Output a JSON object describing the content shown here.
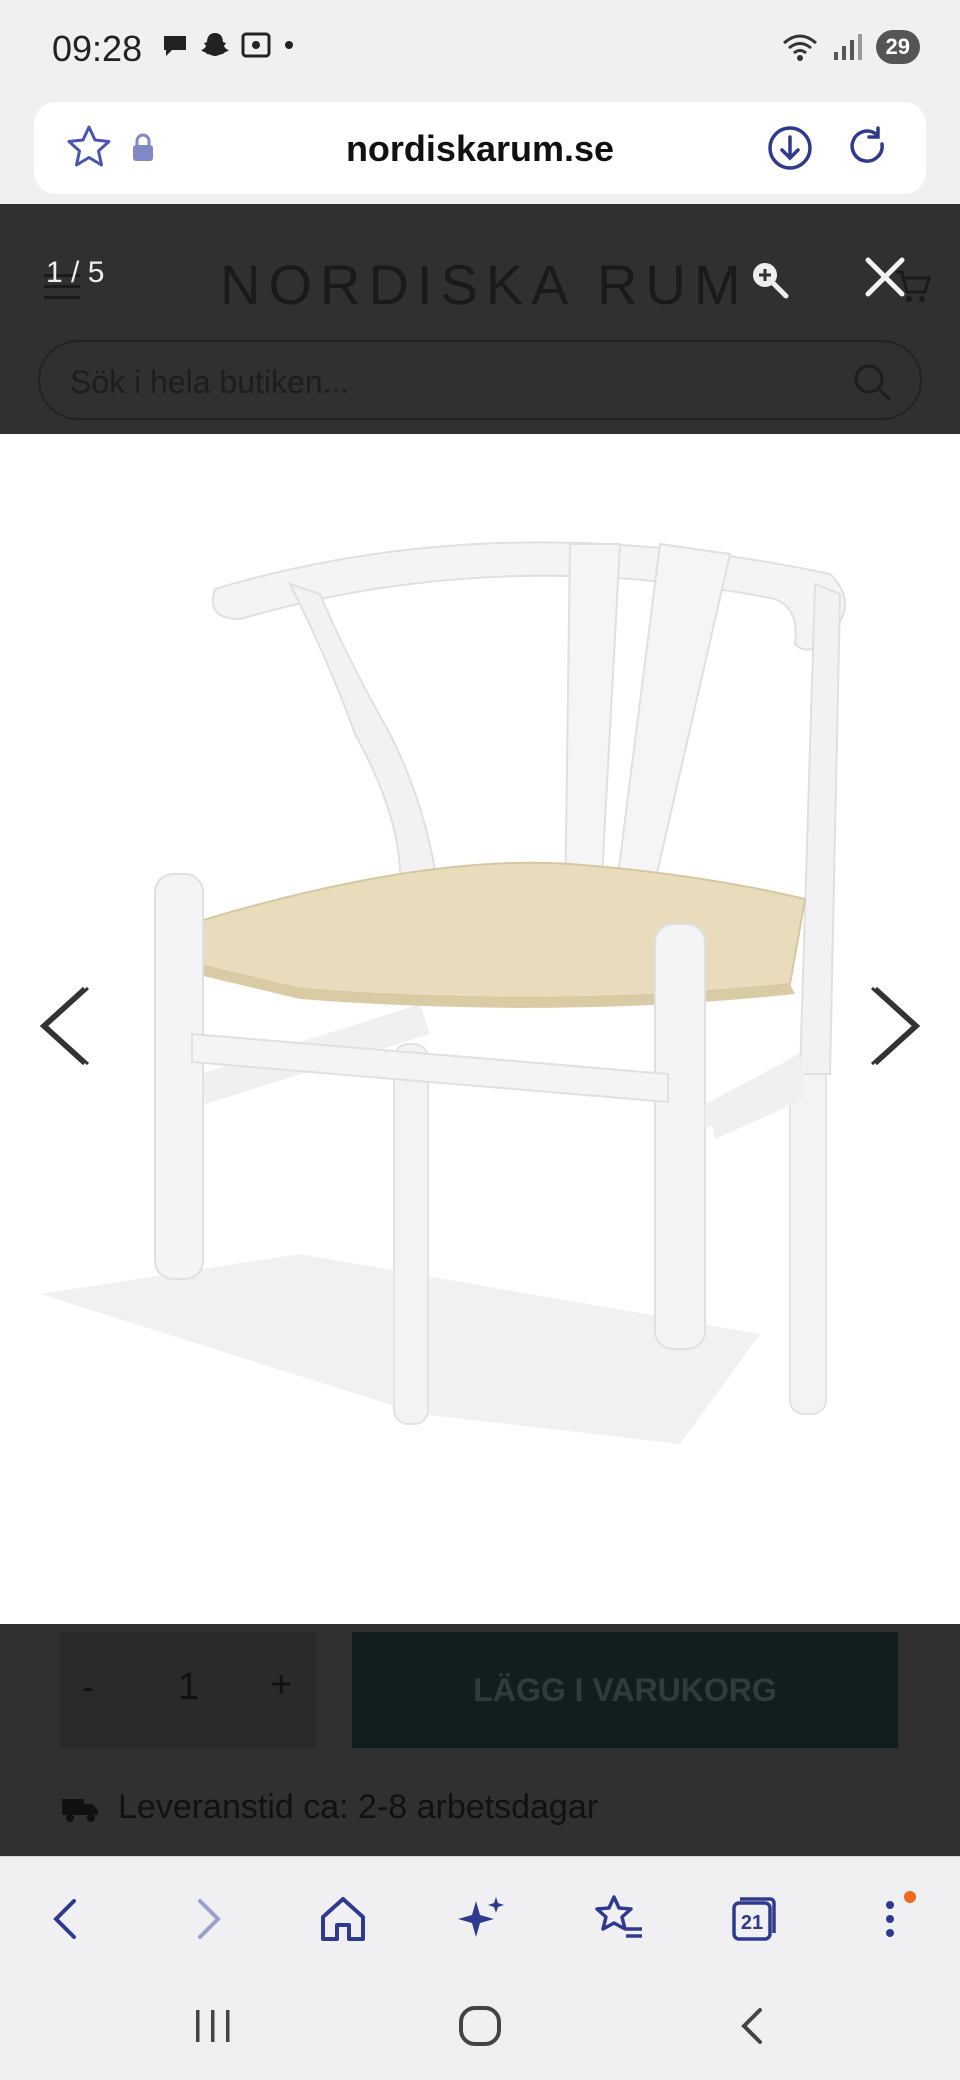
{
  "status": {
    "time": "09:28",
    "battery": "29"
  },
  "browser": {
    "url": "nordiskarum.se",
    "tabs_count": "21"
  },
  "site": {
    "logo": "NORDISKA RUM",
    "search_placeholder": "Sök i hela butiken..."
  },
  "gallery": {
    "counter": "1 / 5"
  },
  "cart": {
    "minus": "-",
    "quantity": "1",
    "plus": "+",
    "add_label": "LÄGG I VARUKORG",
    "delivery": "Leveranstid ca: 2-8 arbetsdagar"
  },
  "colors": {
    "accent": "#2f3a8f",
    "overlay": "#303030",
    "seat": "#e8dcbc"
  },
  "icons": [
    "star-icon",
    "lock-icon",
    "download-icon",
    "reload-icon",
    "menu-icon",
    "cart-icon",
    "zoom-icon",
    "close-icon",
    "search-icon",
    "chevron-left-icon",
    "chevron-right-icon",
    "truck-icon",
    "back-icon",
    "forward-icon",
    "home-icon",
    "sparkle-icon",
    "bookmarks-icon",
    "tabs-icon",
    "more-icon"
  ]
}
